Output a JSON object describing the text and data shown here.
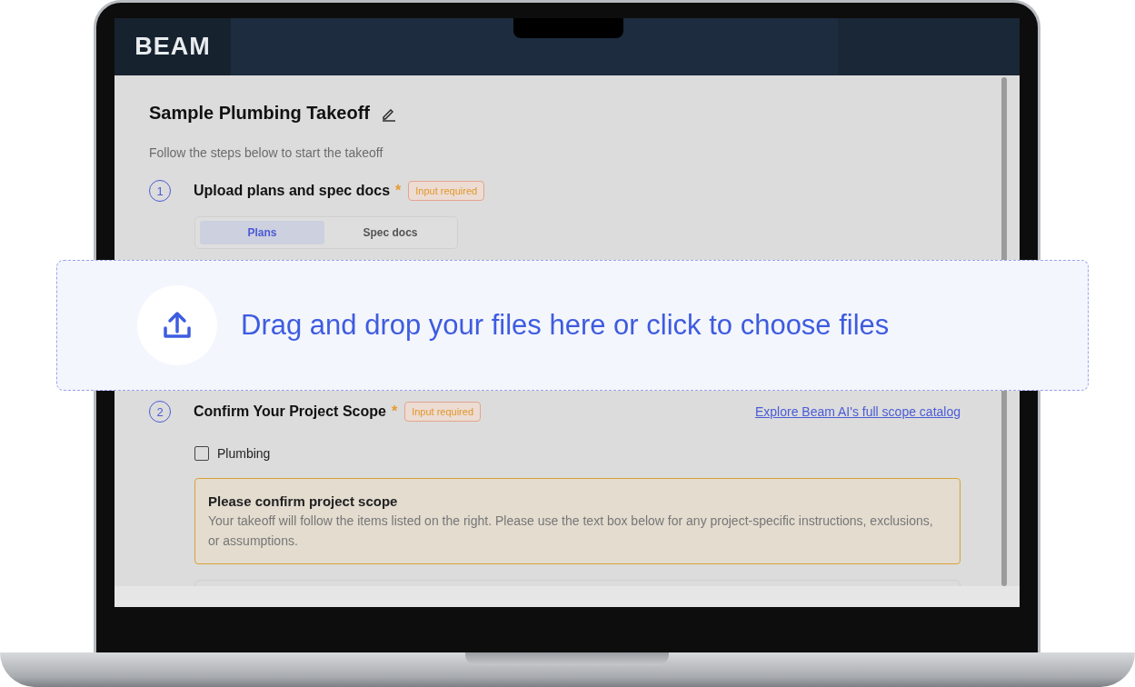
{
  "header": {
    "logo": "BEAM"
  },
  "title": "Sample Plumbing Takeoff",
  "subtitle": "Follow the steps below to start the takeoff",
  "steps": [
    {
      "number": "1",
      "title": "Upload plans and spec docs",
      "required_mark": "*",
      "badge": "Input required"
    },
    {
      "number": "2",
      "title": "Confirm Your Project Scope",
      "required_mark": "*",
      "badge": "Input required",
      "link": "Explore Beam AI's full scope catalog"
    }
  ],
  "upload_tabs": [
    {
      "label": "Plans",
      "selected": true
    },
    {
      "label": "Spec docs",
      "selected": false
    }
  ],
  "scope_options": [
    {
      "label": "Plumbing",
      "checked": false
    }
  ],
  "notice": {
    "title": "Please confirm project scope",
    "text": "Your takeoff will follow the items listed on the right. Please use the text box below for any project-specific instructions, exclusions, or assumptions."
  },
  "dropzone": {
    "text": "Drag and drop your files here or click to choose files"
  }
}
